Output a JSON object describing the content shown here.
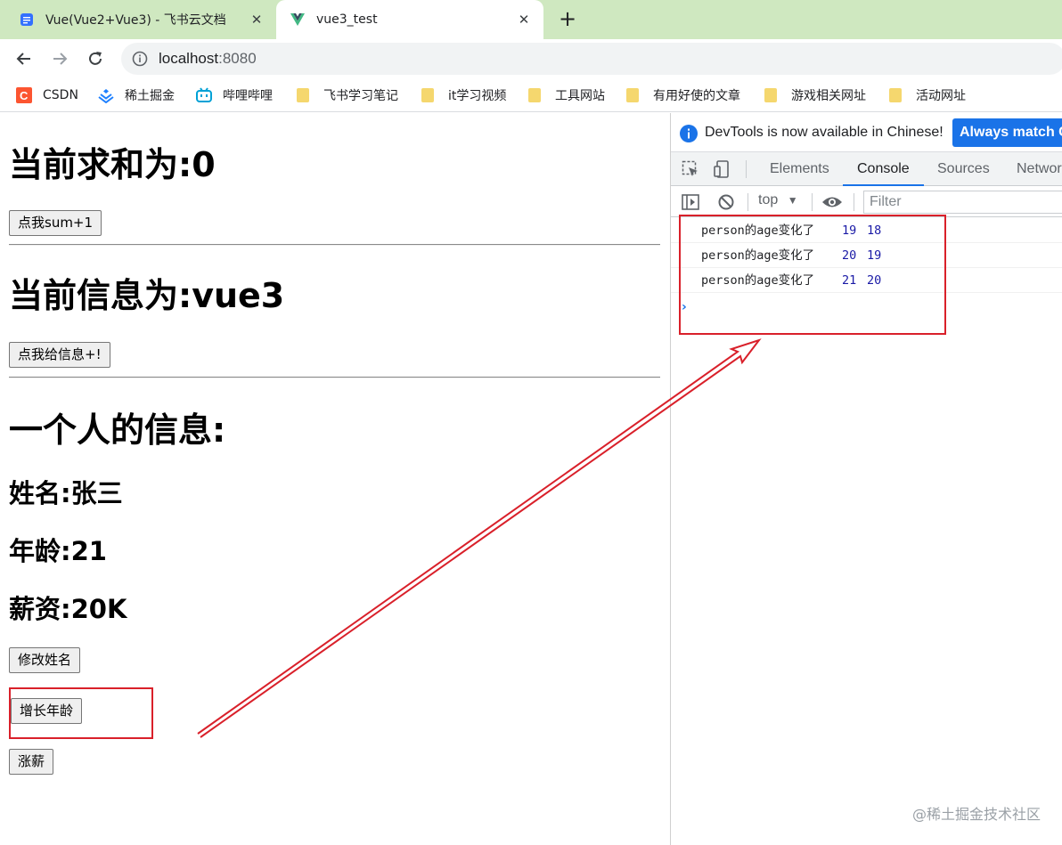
{
  "browser": {
    "tabs": [
      {
        "title": "Vue(Vue2+Vue3) - 飞书云文档",
        "close": "✕"
      },
      {
        "title": "vue3_test",
        "close": "✕"
      }
    ],
    "new_tab": "+",
    "address": {
      "host": "localhost",
      "port": ":8080"
    },
    "bookmarks": [
      "CSDN",
      "稀土掘金",
      "哔哩哔哩",
      "飞书学习笔记",
      "it学习视频",
      "工具网站",
      "有用好使的文章",
      "游戏相关网址",
      "活动网址"
    ]
  },
  "page": {
    "sum_heading": "当前求和为:0",
    "sum_button": "点我sum+1",
    "msg_heading": "当前信息为:vue3",
    "msg_button": "点我给信息+!",
    "person_heading": "一个人的信息:",
    "name": "姓名:张三",
    "age": "年龄:21",
    "salary": "薪资:20K",
    "change_name_button": "修改姓名",
    "grow_age_button": "增长年龄",
    "raise_salary_button": "涨薪"
  },
  "devtools": {
    "banner_text": "DevTools is now available in Chinese!",
    "banner_button": "Always match C",
    "tabs": [
      "Elements",
      "Console",
      "Sources",
      "Networ"
    ],
    "active_tab": "Console",
    "context": "top",
    "filter_placeholder": "Filter",
    "logs": [
      {
        "msg": "person的age变化了",
        "new": "19",
        "old": "18"
      },
      {
        "msg": "person的age变化了",
        "new": "20",
        "old": "19"
      },
      {
        "msg": "person的age变化了",
        "new": "21",
        "old": "20"
      }
    ],
    "prompt": "›"
  },
  "watermark": "@稀土掘金技术社区",
  "colors": {
    "tabstrip": "#cfe8c0",
    "highlight": "#d9202a",
    "devtools_accent": "#1a73e8",
    "console_number": "#1a1aa6"
  }
}
